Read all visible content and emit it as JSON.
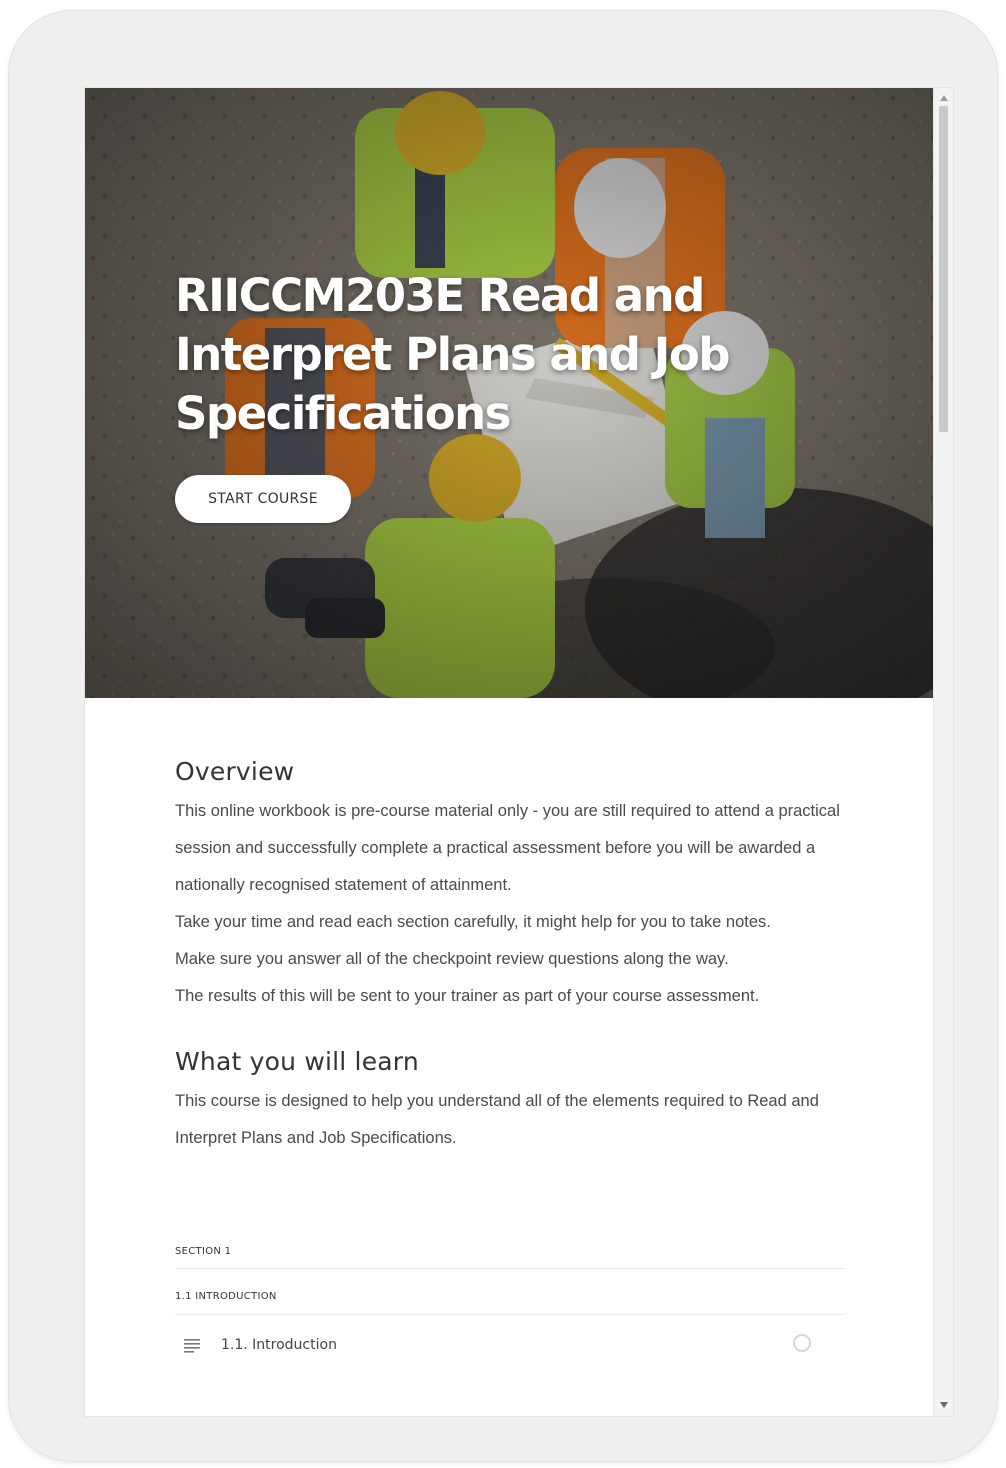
{
  "hero": {
    "title": "RIICCM203E Read and Interpret Plans and Job Specifications",
    "start_button": "START COURSE",
    "image_alt": "Construction workers in hi-vis vests and hard hats reviewing plans"
  },
  "overview": {
    "title": "Overview",
    "paragraphs": [
      "This online workbook is pre-course material only - you are still required to attend a practical session and successfully complete a practical assessment before you will be awarded a nationally recognised statement of attainment.",
      "Take your time and read each section carefully, it might help for you to take notes.",
      "Make sure you answer all of the checkpoint review questions along the way.",
      "The results of this will be sent to your trainer as part of your course assessment."
    ]
  },
  "learn": {
    "title": "What you will learn",
    "paragraph": "This course is designed to help you understand all of the elements required to Read and Interpret Plans and Job Specifications."
  },
  "outline": {
    "section_label": "SECTION 1",
    "subsection_label": "1.1 INTRODUCTION",
    "lessons": [
      {
        "label": "1.1. Introduction",
        "icon": "text-lines-icon",
        "status": "not-started"
      }
    ]
  },
  "colors": {
    "hi_vis_yellow": "#b8e04a",
    "hi_vis_orange": "#ee7a22",
    "hard_hat_yellow": "#e6bd2e",
    "hard_hat_white": "#e9e9e9",
    "ground": "#8c857c"
  }
}
